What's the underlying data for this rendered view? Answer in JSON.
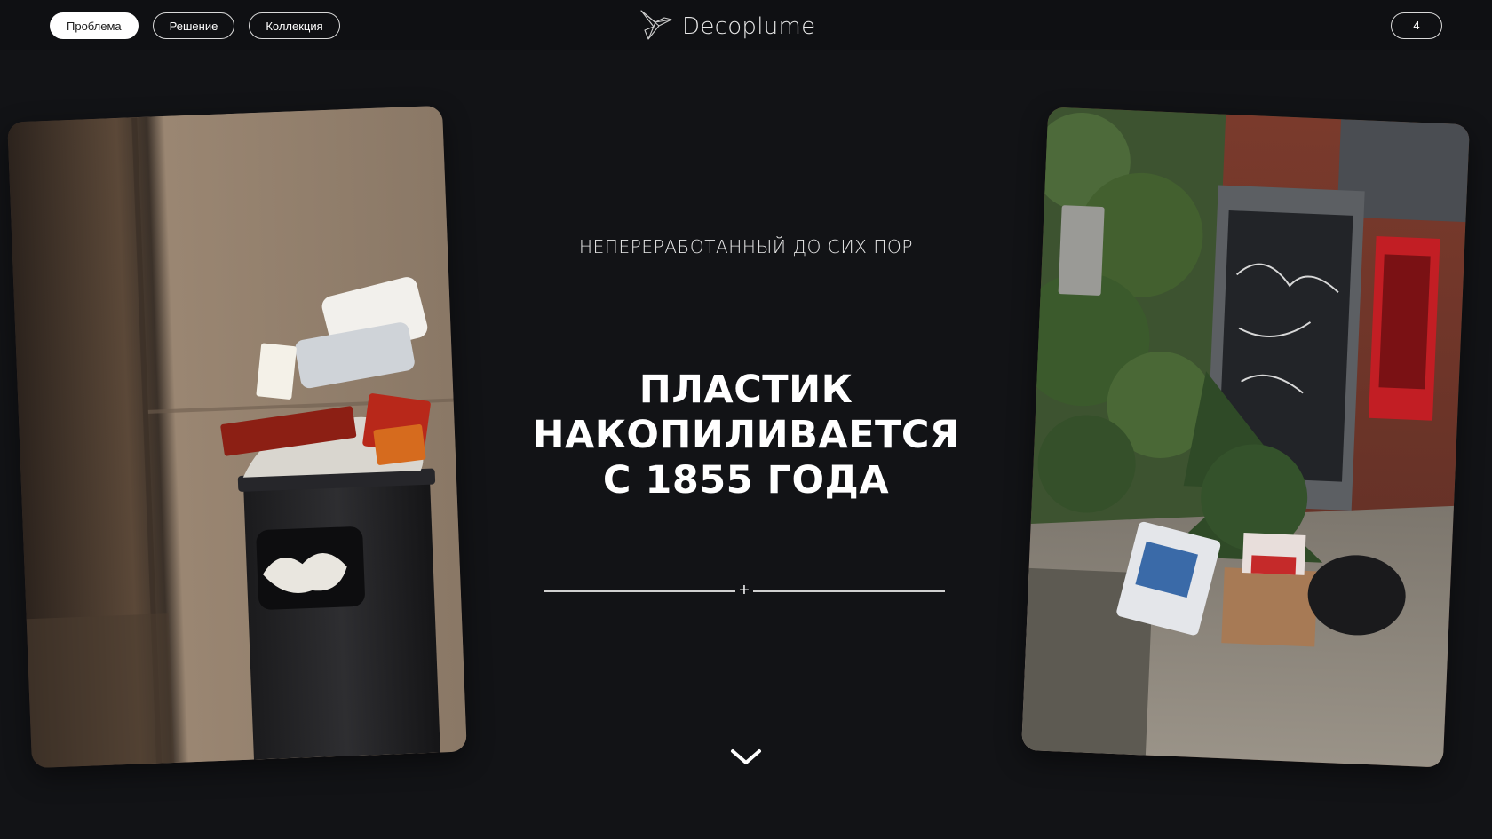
{
  "nav": {
    "items": [
      {
        "label": "Проблема",
        "active": true
      },
      {
        "label": "Решение",
        "active": false
      },
      {
        "label": "Коллекция",
        "active": false
      }
    ]
  },
  "brand": {
    "name": "Decoplume",
    "icon": "bird-logo-icon"
  },
  "counter": {
    "value": "4"
  },
  "hero": {
    "subtitle": "НЕПЕРЕРАБОТАННЫЙ ДО СИХ ПОР",
    "headline_lines": [
      "ПЛАСТИК",
      "НАКОПИЛИВАЕТСЯ",
      "С 1855 ГОДА"
    ],
    "divider_symbol": "+",
    "scroll_icon": "chevron-down-icon"
  },
  "images": {
    "left": {
      "subject": "overflowing-trash-bin-photo"
    },
    "right": {
      "subject": "street-garbage-phone-booth-photo"
    }
  },
  "colors": {
    "background": "#121316",
    "text": "#ffffff",
    "pill_active_bg": "#ffffff",
    "pill_border": "#d9d9d9"
  }
}
